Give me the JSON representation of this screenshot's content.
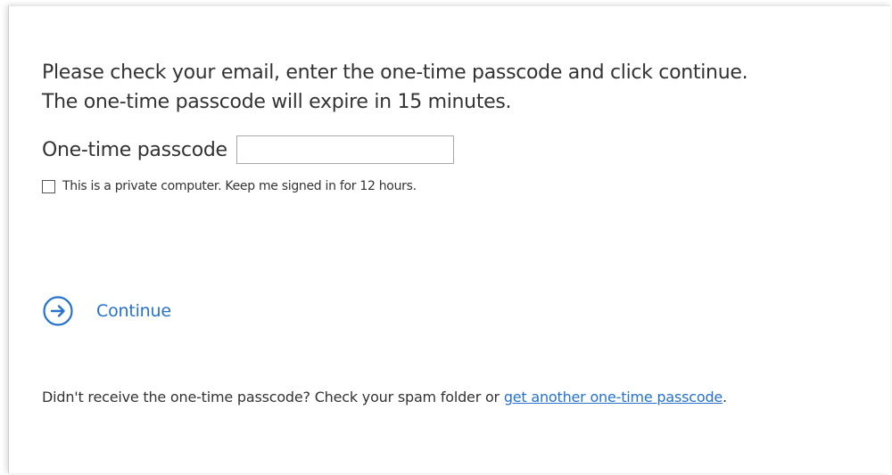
{
  "instructions": {
    "line1": "Please check your email, enter the one-time passcode and click continue.",
    "line2": "The one-time passcode will expire in 15 minutes."
  },
  "passcode": {
    "label": "One-time passcode",
    "value": "",
    "placeholder": ""
  },
  "keep_signed_in": {
    "label": "This is a private computer. Keep me signed in for 12 hours.",
    "checked": false
  },
  "continue": {
    "label": "Continue",
    "icon": "arrow-right-circle-icon"
  },
  "resend": {
    "text": "Didn't receive the one-time passcode? Check your spam folder or ",
    "link_label": "get another one-time passcode",
    "suffix": "."
  },
  "colors": {
    "accent": "#2672cc",
    "text": "#333333",
    "border": "#a8a8a8"
  }
}
